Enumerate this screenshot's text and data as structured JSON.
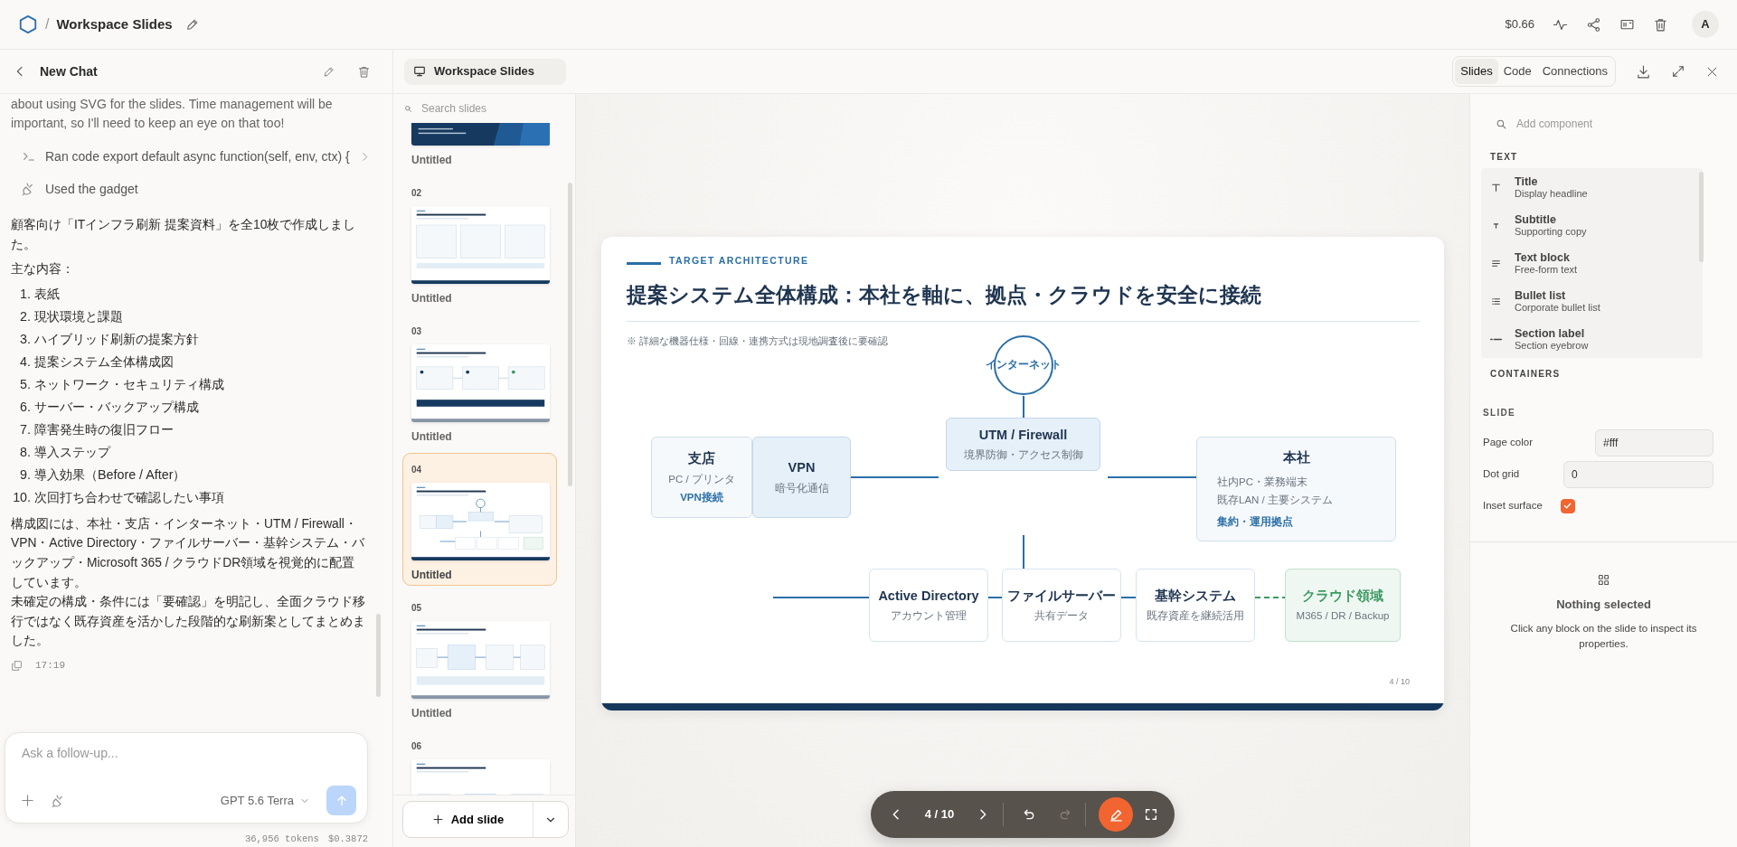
{
  "app_bar": {
    "separator": "/",
    "title": "Workspace Slides",
    "cost": "$0.66",
    "avatar": "A"
  },
  "chat": {
    "title": "New Chat",
    "blocks": [
      {
        "kind": "thought",
        "lines": [
          "about using SVG for the slides. Time management will be important, so I'll need to keep an eye on that too!"
        ]
      },
      {
        "kind": "code",
        "lines": [
          "Ran code export default async function(self, env, ctx) {"
        ]
      },
      {
        "kind": "gadget",
        "lines": [
          "Used the gadget"
        ]
      },
      {
        "kind": "paragraph",
        "lines": [
          "顧客向け「ITインフラ刷新 提案資料」を全10枚で作成しました。"
        ]
      },
      {
        "kind": "paragraph",
        "lines": [
          "主な内容："
        ]
      },
      {
        "kind": "list",
        "items": [
          {
            "number": "1.",
            "text": "表紙"
          },
          {
            "number": "2.",
            "text": "現状環境と課題"
          },
          {
            "number": "3.",
            "text": "ハイブリッド刷新の提案方針"
          },
          {
            "number": "4.",
            "text": "提案システム全体構成図"
          },
          {
            "number": "5.",
            "text": "ネットワーク・セキュリティ構成"
          },
          {
            "number": "6.",
            "text": "サーバー・バックアップ構成"
          },
          {
            "number": "7.",
            "text": "障害発生時の復旧フロー"
          },
          {
            "number": "8.",
            "text": "導入ステップ"
          },
          {
            "number": "9.",
            "text": "導入効果（Before / After）"
          },
          {
            "number": "10.",
            "text": "次回打ち合わせで確認したい事項"
          }
        ]
      },
      {
        "kind": "paragraph",
        "lines": [
          "構成図には、本社・支店・インターネット・UTM / Firewall・VPN・Active Directory・ファイルサーバー・基幹システム・バックアップ・Microsoft 365 / クラウドDR領域を視覚的に配置しています。",
          "未確定の構成・条件には「要確認」を明記し、全面クラウド移行ではなく既存資産を活かした段階的な刷新案としてまとめました。"
        ]
      }
    ],
    "time": "17:19",
    "composer": {
      "placeholder": "Ask a follow-up...",
      "model": "GPT 5.6 Terra",
      "send_disabled": true
    },
    "usage": {
      "tokens": "36,956 tokens",
      "cost": "$0.3872"
    }
  },
  "editor": {
    "title": "Workspace Slides",
    "tabs": [
      {
        "label": "Slides",
        "selected": true
      },
      {
        "label": "Code",
        "selected": false
      },
      {
        "label": "Connections",
        "selected": false
      }
    ]
  },
  "slides_panel": {
    "search": {
      "placeholder": "Search slides"
    },
    "slides": [
      {
        "kind": "cover",
        "label": "Untitled",
        "selected": false
      },
      {
        "number": "02",
        "kind": "cards",
        "label": "Untitled",
        "selected": false
      },
      {
        "number": "03",
        "kind": "flow",
        "label": "Untitled",
        "selected": false
      },
      {
        "number": "04",
        "kind": "diagram",
        "label": "Untitled",
        "selected": true
      },
      {
        "number": "05",
        "kind": "network",
        "label": "Untitled",
        "selected": false
      },
      {
        "number": "06",
        "kind": "backup",
        "selected": false
      }
    ],
    "add_button": "Add slide"
  },
  "slide": {
    "eyebrow": "TARGET ARCHITECTURE",
    "title": "提案システム全体構成：本社を軸に、拠点・クラウドを安全に接続",
    "note": "※ 詳細な機器仕様・回線・連携方式は現地調査後に要確認",
    "nodes": [
      {
        "kind": "circle",
        "title": "インターネット"
      },
      {
        "kind": "box",
        "color": "#e6f0f9",
        "title": "UTM / Firewall",
        "lines": [
          "境界防御・アクセス制御"
        ]
      },
      {
        "kind": "box",
        "color": "#f6f9fc",
        "title": "支店",
        "lines": [
          "PC / プリンタ"
        ],
        "accent": "VPN接続"
      },
      {
        "kind": "box",
        "color": "#e6f0f9",
        "title": "VPN",
        "lines": [
          "暗号化通信"
        ]
      },
      {
        "kind": "box",
        "color": "#f6f9fc",
        "title": "本社",
        "lines": [
          "社内PC・業務端末",
          "既存LAN / 主要システム"
        ],
        "accent": "集約・運用拠点"
      },
      {
        "kind": "box",
        "color": "#ffffff",
        "title": "Active Directory",
        "lines": [
          "アカウント管理"
        ]
      },
      {
        "kind": "box",
        "color": "#ffffff",
        "title": "ファイルサーバー",
        "lines": [
          "共有データ"
        ]
      },
      {
        "kind": "box",
        "color": "#ffffff",
        "title": "基幹システム",
        "lines": [
          "既存資産を継続活用"
        ]
      },
      {
        "kind": "cloud",
        "color": "#eef7f1",
        "title": "クラウド領域",
        "lines": [
          "M365 / DR / Backup"
        ]
      }
    ],
    "page": "4 / 10"
  },
  "toolbar": {
    "page": "4 / 10",
    "redo_disabled": true,
    "pen_active": true
  },
  "inspector": {
    "search": {
      "placeholder": "Add component"
    },
    "groups": [
      {
        "heading": "TEXT",
        "items": [
          {
            "kind": "title",
            "title": "Title",
            "description": "Display headline"
          },
          {
            "kind": "subtitle",
            "title": "Subtitle",
            "description": "Supporting copy"
          },
          {
            "kind": "text",
            "title": "Text block",
            "description": "Free-form text"
          },
          {
            "kind": "bullets",
            "title": "Bullet list",
            "description": "Corporate bullet list"
          },
          {
            "kind": "label",
            "title": "Section label",
            "description": "Section eyebrow"
          }
        ]
      },
      {
        "heading": "CONTAINERS"
      }
    ],
    "section": "SLIDE",
    "fields": [
      {
        "kind": "text",
        "label": "Page color",
        "value": "#fff"
      },
      {
        "kind": "number",
        "label": "Dot grid",
        "value": "0"
      },
      {
        "kind": "checkbox",
        "label": "Inset surface",
        "checked": true
      }
    ],
    "empty": {
      "title": "Nothing selected",
      "text": "Click any block on the slide to inspect its properties."
    }
  }
}
